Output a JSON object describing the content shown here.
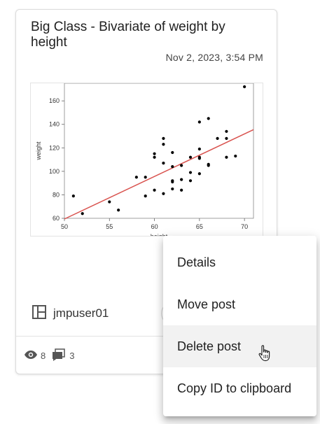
{
  "post": {
    "title": "Big Class - Bivariate of weight by height",
    "timestamp": "Nov 2, 2023, 3:54 PM",
    "author": "jmpuser01",
    "views": "8",
    "comments": "3"
  },
  "menu": {
    "items": [
      {
        "label": "Details"
      },
      {
        "label": "Move post"
      },
      {
        "label": "Delete post"
      },
      {
        "label": "Copy ID to clipboard"
      }
    ],
    "hovered_index": 2
  },
  "icons": {
    "author": "layout-grid-icon",
    "views": "eye-icon",
    "comments": "comment-bubble-icon",
    "cursor": "hand-pointer-icon"
  },
  "colors": {
    "fit_line": "#d9534f",
    "points": "#000000",
    "icon": "#555555"
  },
  "chart_data": {
    "type": "scatter",
    "title": "",
    "xlabel": "height",
    "ylabel": "weight",
    "xlim": [
      50,
      71
    ],
    "ylim": [
      60,
      175
    ],
    "xticks": [
      50,
      55,
      60,
      65,
      70
    ],
    "yticks": [
      60,
      80,
      100,
      120,
      140,
      160
    ],
    "points": [
      [
        51,
        79
      ],
      [
        52,
        64
      ],
      [
        55,
        74
      ],
      [
        56,
        67
      ],
      [
        58,
        95
      ],
      [
        59,
        79
      ],
      [
        59,
        95
      ],
      [
        60,
        84
      ],
      [
        60,
        112
      ],
      [
        60,
        115
      ],
      [
        61,
        81
      ],
      [
        61,
        107
      ],
      [
        61,
        123
      ],
      [
        61,
        128
      ],
      [
        62,
        85
      ],
      [
        62,
        91
      ],
      [
        62,
        92
      ],
      [
        62,
        104
      ],
      [
        62,
        116
      ],
      [
        63,
        84
      ],
      [
        63,
        93
      ],
      [
        63,
        105
      ],
      [
        64,
        92
      ],
      [
        64,
        99
      ],
      [
        64,
        112
      ],
      [
        65,
        98
      ],
      [
        65,
        111
      ],
      [
        65,
        112
      ],
      [
        65,
        119
      ],
      [
        65,
        142
      ],
      [
        66,
        105
      ],
      [
        66,
        106
      ],
      [
        66,
        145
      ],
      [
        67,
        128
      ],
      [
        68,
        112
      ],
      [
        68,
        128
      ],
      [
        68,
        134
      ],
      [
        69,
        113
      ],
      [
        70,
        172
      ]
    ],
    "fit_line": {
      "x": [
        50,
        71
      ],
      "y": [
        59.4,
        135.5
      ]
    }
  }
}
